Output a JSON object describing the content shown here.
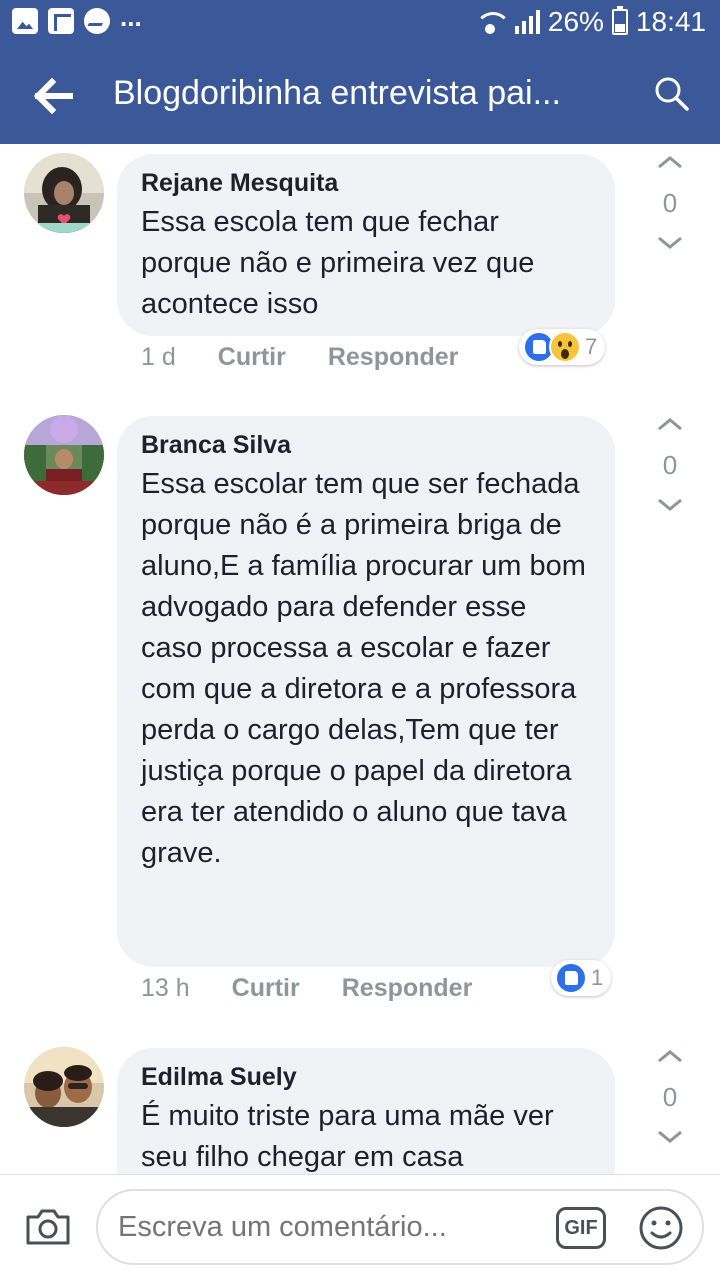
{
  "status_bar": {
    "battery": "26%",
    "time": "18:41",
    "overflow": "..."
  },
  "header": {
    "title": "Blogdoribinha entrevista pai..."
  },
  "comments": [
    {
      "author": "Rejane Mesquita",
      "text": "Essa escola tem que fechar porque não e primeira vez que acontece isso",
      "time": "1 d",
      "like_label": "Curtir",
      "reply_label": "Responder",
      "reaction_count": "7",
      "reactions": [
        "like",
        "wow"
      ],
      "vote_count": "0"
    },
    {
      "author": "Branca Silva",
      "text": "Essa escolar tem que ser fechada porque não é a primeira briga de aluno,E a família procurar um bom advogado para defender esse caso processa a escolar e fazer com que a diretora e a professora perda o cargo delas,Tem que ter justiça porque o papel da diretora era ter atendido o aluno que tava grave.",
      "time": "13 h",
      "like_label": "Curtir",
      "reply_label": "Responder",
      "reaction_count": "1",
      "reactions": [
        "like"
      ],
      "vote_count": "0"
    },
    {
      "author": "Edilma Suely",
      "text": "É muito triste para uma mãe ver seu filho chegar em casa",
      "vote_count": "0"
    }
  ],
  "composer": {
    "placeholder": "Escreva um comentário...",
    "gif_label": "GIF"
  },
  "colors": {
    "brand": "#3b5998",
    "bubble": "#f1f2f6",
    "meta_text": "#90949c",
    "like_blue": "#2d6fe6",
    "wow_yellow": "#f7c33d"
  },
  "icons": [
    "gallery-icon",
    "flipboard-icon",
    "messenger-icon",
    "wifi-icon",
    "signal-icon",
    "battery-icon",
    "back-arrow-icon",
    "search-icon",
    "chevron-up-icon",
    "chevron-down-icon",
    "camera-icon",
    "gif-icon",
    "emoji-icon"
  ]
}
